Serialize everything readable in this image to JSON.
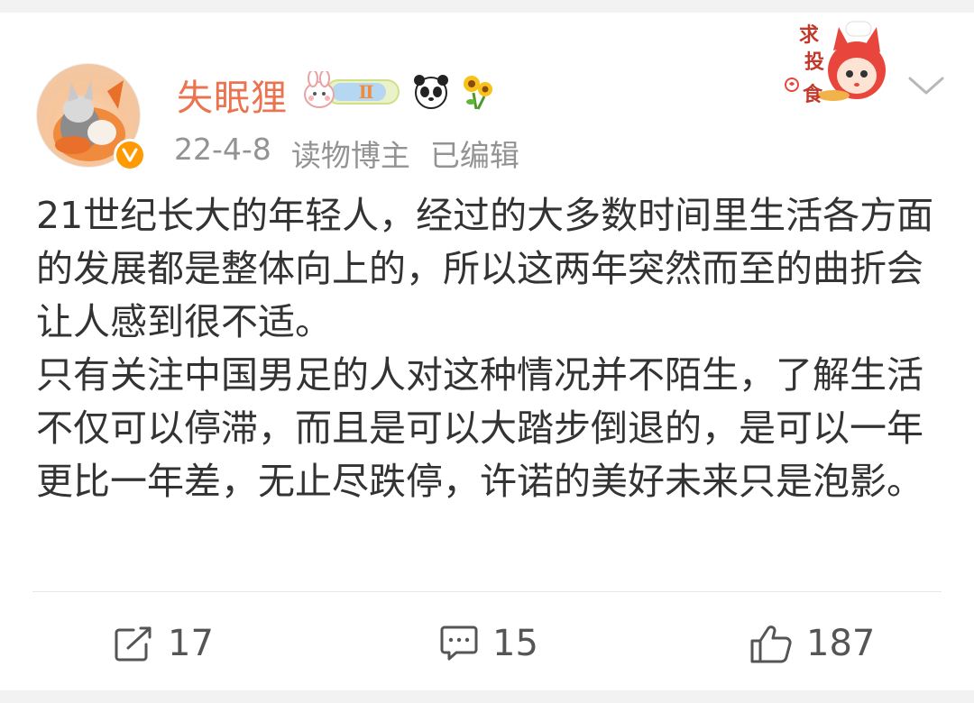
{
  "post": {
    "author": "失眠狸",
    "date": "22-4-8",
    "role": "读物博主",
    "edited": "已编辑",
    "content": [
      "21世纪长大的年轻人，经过的大多数时间里生活各方面的发展都是整体向上的，所以这两年突然而至的曲折会让人感到很不适。",
      "只有关注中国男足的人对这种情况并不陌生，了解生活不仅可以停滞，而且是可以大踏步倒退的，是可以一年更比一年差，无止尽跌停，许诺的美好未来只是泡影。"
    ],
    "badge_level": "Ⅱ",
    "sticker_text": [
      "求",
      "投",
      "食"
    ]
  },
  "actions": {
    "repost_count": "17",
    "comment_count": "15",
    "like_count": "187"
  },
  "icons": {
    "repost": "share-square-icon",
    "comment": "comment-bubble-icon",
    "like": "thumbs-up-icon",
    "more": "chevron-down-icon",
    "verified": "verified-v-icon"
  },
  "colors": {
    "author_name": "#eb7350",
    "meta_text": "#939393",
    "body_text": "#333333",
    "verified_badge": "#ff9a00"
  }
}
